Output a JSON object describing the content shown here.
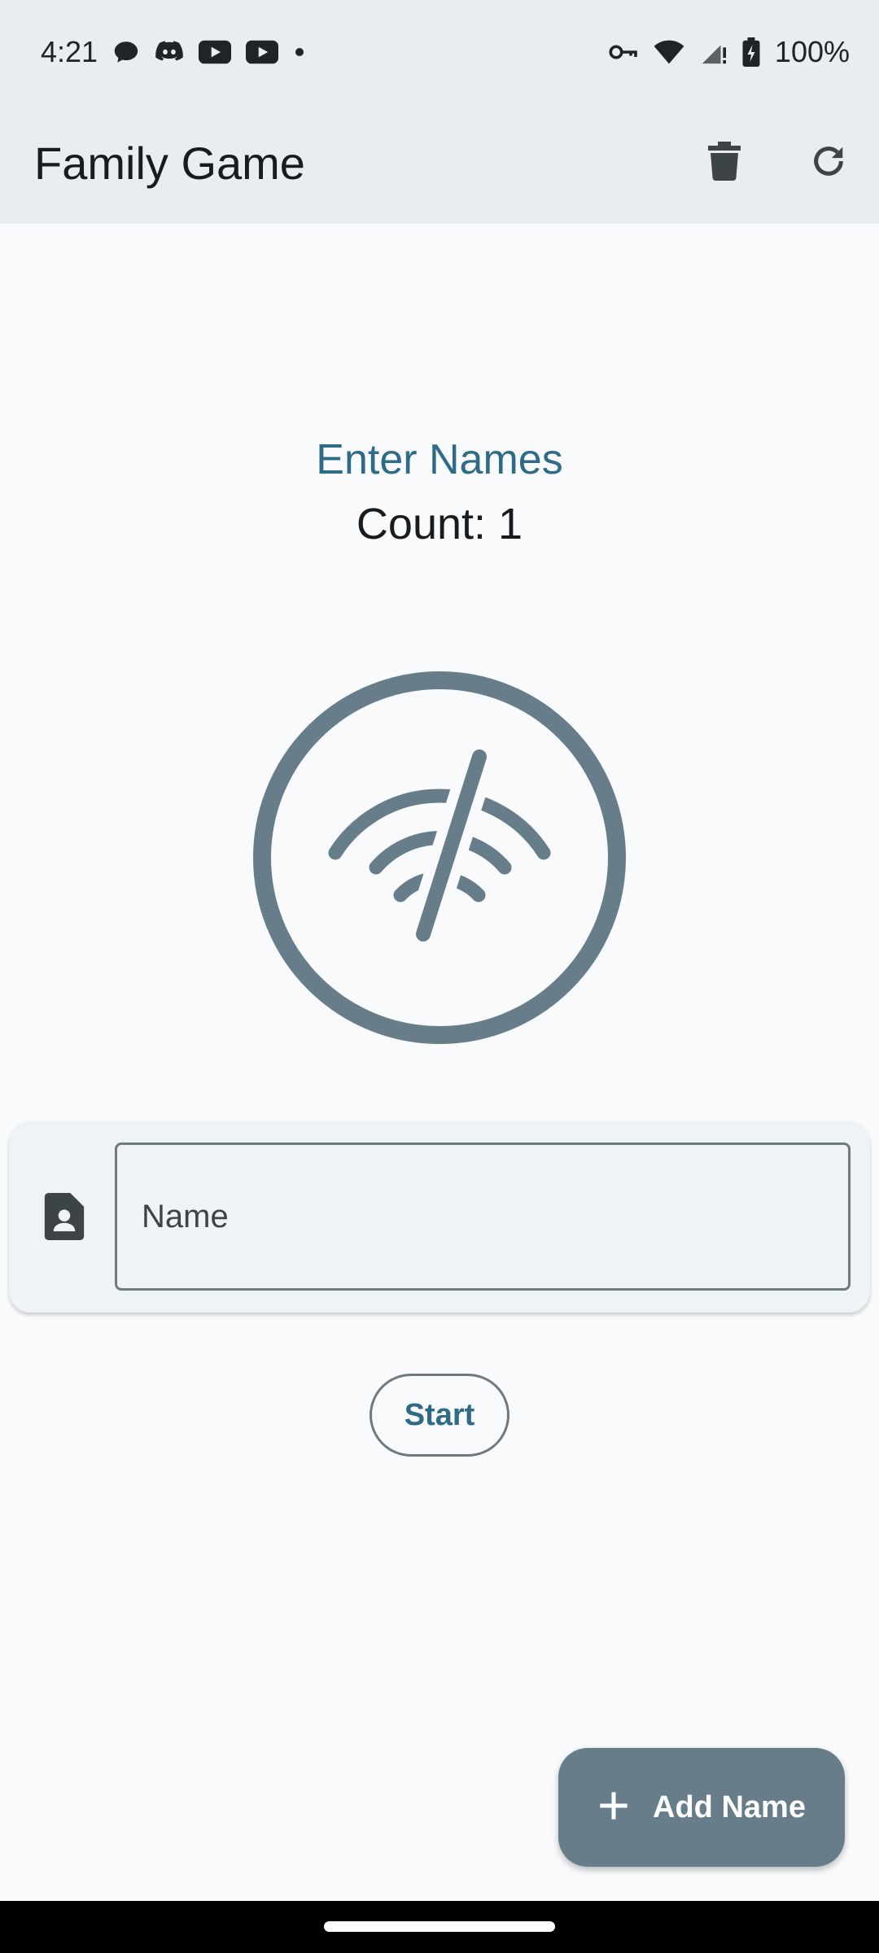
{
  "status_bar": {
    "time": "4:21",
    "battery": "100%",
    "icons": [
      "chat-bubble-icon",
      "discord-icon",
      "youtube-icon",
      "youtube-icon",
      "dot-icon",
      "vpn-key-icon",
      "wifi-icon",
      "signal-icon",
      "battery-charging-icon"
    ]
  },
  "app_bar": {
    "title": "Family Game",
    "actions": [
      "delete-icon",
      "refresh-icon"
    ]
  },
  "main": {
    "heading": "Enter Names",
    "count_text": "Count: 1",
    "hero_icon": "wifi-off-icon"
  },
  "name_card": {
    "icon": "contact-file-icon",
    "placeholder": "Name",
    "value": ""
  },
  "start_button": {
    "label": "Start"
  },
  "fab": {
    "label": "Add Name",
    "icon": "plus-icon"
  },
  "colors": {
    "accent": "#2f6a86",
    "surface": "#e7edf0",
    "background": "#f8fafb",
    "fab": "#687d8a"
  }
}
